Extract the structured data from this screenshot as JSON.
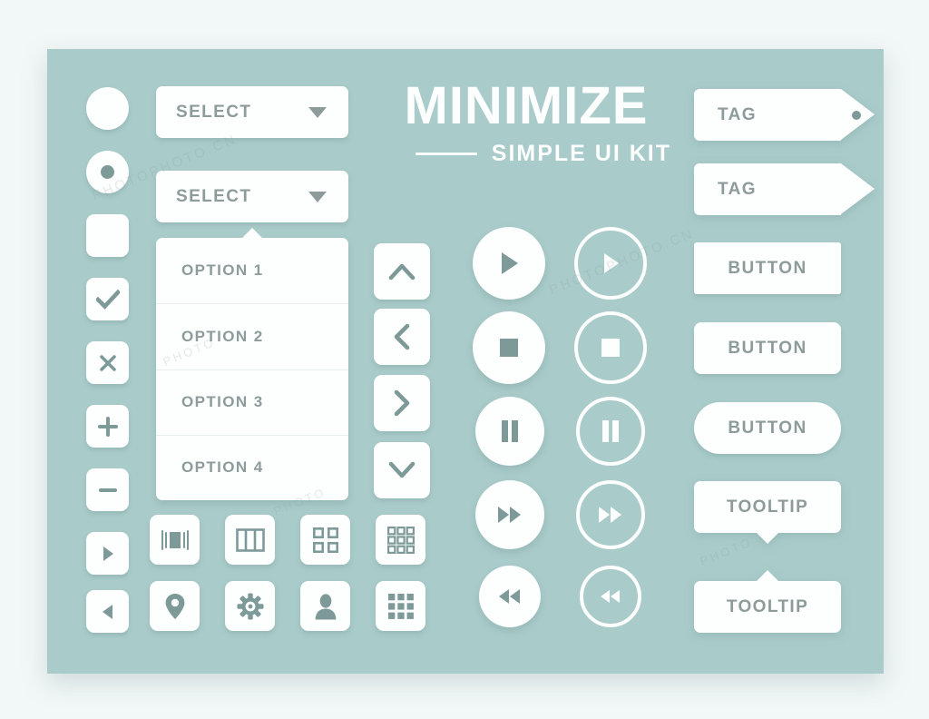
{
  "header": {
    "title": "MINIMIZE",
    "subtitle": "SIMPLE UI KIT"
  },
  "colors": {
    "page_background": "#f2f7f7",
    "panel_background": "#a9cbc9",
    "surface": "#fdfefe",
    "text": "#8d9c9b",
    "icon": "#7d9a99"
  },
  "left_controls": [
    {
      "name": "radio-unchecked",
      "icon": "radio-empty-icon",
      "checked": false
    },
    {
      "name": "radio-checked",
      "icon": "radio-filled-icon",
      "checked": true
    },
    {
      "name": "checkbox-unchecked",
      "icon": "checkbox-empty-icon",
      "checked": false
    },
    {
      "name": "checkbox-checked",
      "icon": "check-icon",
      "checked": true
    },
    {
      "name": "close-button",
      "icon": "close-icon"
    },
    {
      "name": "plus-button",
      "icon": "plus-icon"
    },
    {
      "name": "minus-button",
      "icon": "minus-icon"
    },
    {
      "name": "next-button",
      "icon": "triangle-right-icon"
    },
    {
      "name": "previous-button",
      "icon": "triangle-left-icon"
    }
  ],
  "selects": [
    {
      "label": "SELECT",
      "caret": "chevron-down-icon"
    },
    {
      "label": "SELECT",
      "caret": "chevron-down-icon"
    }
  ],
  "dropdown": {
    "options": [
      "OPTION 1",
      "OPTION 2",
      "OPTION 3",
      "OPTION 4"
    ]
  },
  "chevron_buttons": [
    {
      "name": "chevron-up-button",
      "icon": "chevron-up-icon"
    },
    {
      "name": "chevron-left-button",
      "icon": "chevron-left-icon"
    },
    {
      "name": "chevron-right-button",
      "icon": "chevron-right-icon"
    },
    {
      "name": "chevron-down-button",
      "icon": "chevron-down-icon"
    }
  ],
  "media_filled": [
    {
      "name": "play-button",
      "icon": "play-icon"
    },
    {
      "name": "stop-button",
      "icon": "stop-icon"
    },
    {
      "name": "pause-button",
      "icon": "pause-icon"
    },
    {
      "name": "fast-forward-button",
      "icon": "fast-forward-icon"
    },
    {
      "name": "rewind-button",
      "icon": "rewind-icon"
    }
  ],
  "media_outlined": [
    {
      "name": "play-outline-button",
      "icon": "play-icon"
    },
    {
      "name": "stop-outline-button",
      "icon": "stop-icon"
    },
    {
      "name": "pause-outline-button",
      "icon": "pause-icon"
    },
    {
      "name": "fast-forward-outline-button",
      "icon": "fast-forward-icon"
    },
    {
      "name": "rewind-outline-button",
      "icon": "rewind-icon"
    }
  ],
  "right_column": {
    "tags": [
      {
        "label": "TAG",
        "has_hole": true
      },
      {
        "label": "TAG",
        "has_hole": false
      }
    ],
    "buttons": [
      {
        "label": "BUTTON",
        "shape": "square"
      },
      {
        "label": "BUTTON",
        "shape": "rounded"
      },
      {
        "label": "BUTTON",
        "shape": "pill"
      }
    ],
    "tooltips": [
      {
        "label": "TOOLTIP",
        "tail": "down"
      },
      {
        "label": "TOOLTIP",
        "tail": "up"
      }
    ]
  },
  "icon_rows": [
    [
      {
        "name": "fit-width-button",
        "icon": "fit-width-icon"
      },
      {
        "name": "columns-layout-button",
        "icon": "columns-icon"
      },
      {
        "name": "grid-2x2-button",
        "icon": "grid-2x2-icon"
      },
      {
        "name": "grid-3x3-button",
        "icon": "grid-3x3-icon"
      }
    ],
    [
      {
        "name": "location-button",
        "icon": "map-pin-icon"
      },
      {
        "name": "settings-button",
        "icon": "gear-icon"
      },
      {
        "name": "profile-button",
        "icon": "user-icon"
      },
      {
        "name": "apps-button",
        "icon": "apps-grid-icon"
      }
    ]
  ],
  "watermark": {
    "text_cn": "PHOTOPHOTO.CN",
    "text_short": "PHOTO"
  }
}
